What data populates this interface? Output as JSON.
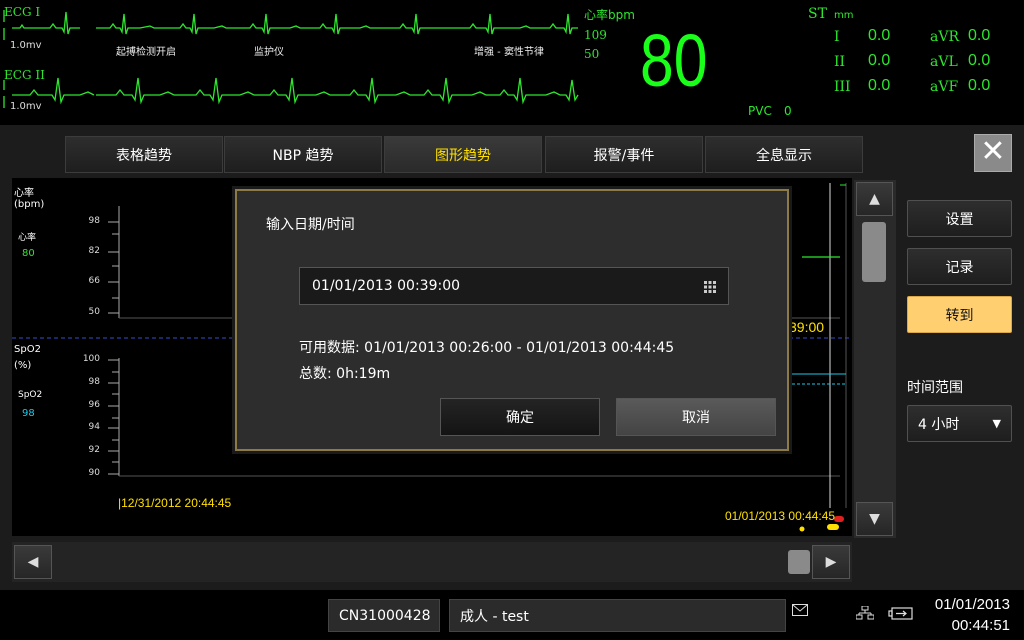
{
  "monitor": {
    "ecg1": {
      "label": "ECG I",
      "scale": "1.0mv"
    },
    "ecg2": {
      "label": "ECG II",
      "scale": "1.0mv"
    },
    "wave_notes": [
      "起搏检测开启",
      "监护仪",
      "增强 - 窦性节律"
    ],
    "hr": {
      "title": "心率bpm",
      "upper": "109",
      "lower": "50",
      "value": "80",
      "pvc_label": "PVC",
      "pvc_value": "0"
    },
    "st": {
      "title": "ST",
      "unit": "mm",
      "leads": [
        {
          "name": "I",
          "value": "0.0"
        },
        {
          "name": "II",
          "value": "0.0"
        },
        {
          "name": "III",
          "value": "0.0"
        },
        {
          "name": "aVR",
          "value": "0.0"
        },
        {
          "name": "aVL",
          "value": "0.0"
        },
        {
          "name": "aVF",
          "value": "0.0"
        }
      ]
    }
  },
  "tabs": [
    {
      "label": "表格趋势",
      "active": false
    },
    {
      "label": "NBP 趋势",
      "active": false
    },
    {
      "label": "图形趋势",
      "active": true
    },
    {
      "label": "报警/事件",
      "active": false
    },
    {
      "label": "全息显示",
      "active": false
    }
  ],
  "close_icon": "close-icon",
  "graph": {
    "hr_section": {
      "title_line1": "心率",
      "title_line2": "(bpm)",
      "param": "心率",
      "param_value": "80",
      "ticks": [
        "98",
        "82",
        "66",
        "50"
      ]
    },
    "spo2_section": {
      "title_line1": "SpO2",
      "title_line2": "(%)",
      "param": "SpO2",
      "param_value": "98",
      "ticks": [
        "100",
        "98",
        "96",
        "94",
        "92",
        "90"
      ]
    },
    "start_time": "12/31/2012 20:44:45",
    "end_time": "01/01/2013 00:44:45",
    "cursor_time_partial": "39:00"
  },
  "right_panel": {
    "settings": "设置",
    "record": "记录",
    "goto": "转到",
    "time_range_label": "时间范围",
    "time_range_value": "4 小时"
  },
  "dialog": {
    "title": "输入日期/时间",
    "input_value": "01/01/2013 00:39:00",
    "available": "可用数据: 01/01/2013 00:26:00 - 01/01/2013 00:44:45",
    "total": "总数: 0h:19m",
    "ok": "确定",
    "cancel": "取消"
  },
  "statusbar": {
    "device_id": "CN31000428",
    "patient": "成人 - test",
    "date": "01/01/2013",
    "time": "00:44:51"
  },
  "colors": {
    "waveform": "#2ee62e",
    "hr_big": "#1aff1a",
    "accent_yellow": "#ffe000",
    "goto_button": "#ffcf70",
    "spo2": "#1ec8e6",
    "dialog_border": "#8c7a48"
  }
}
